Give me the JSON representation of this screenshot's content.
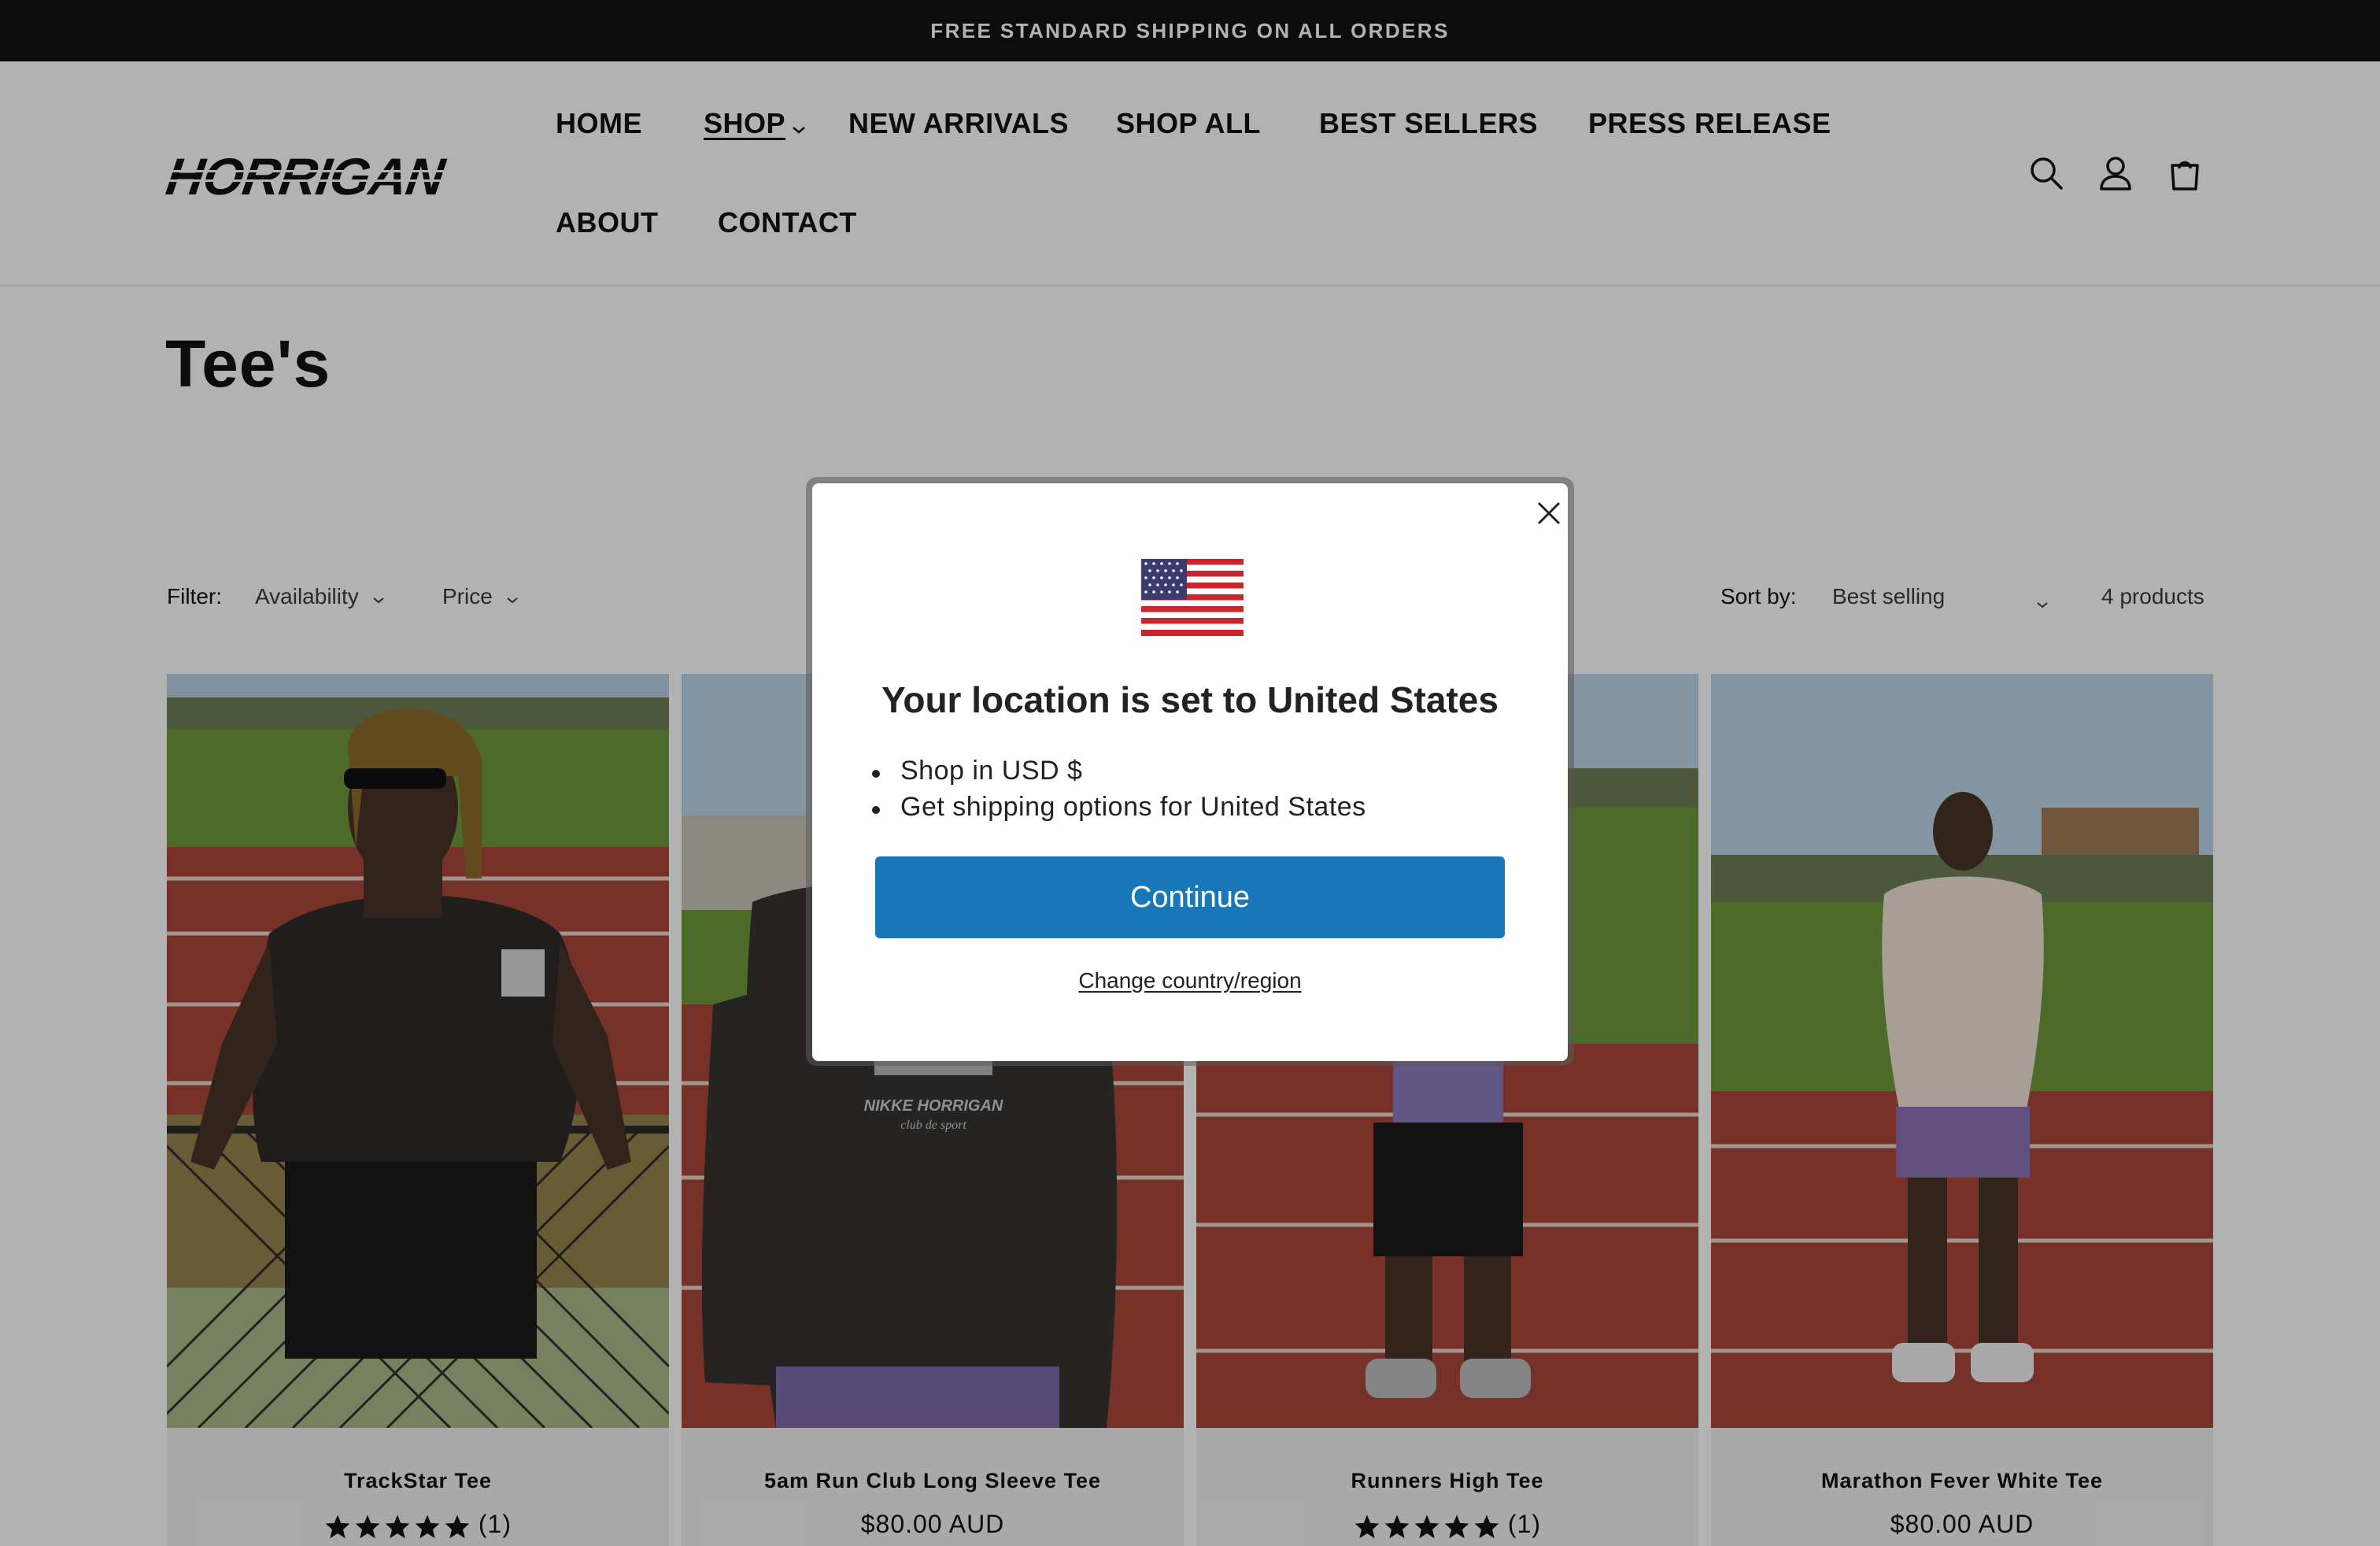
{
  "announcement": "FREE STANDARD SHIPPING ON ALL ORDERS",
  "brand": "HORRIGAN",
  "nav": {
    "home": "HOME",
    "shop": "SHOP",
    "new_arrivals": "NEW ARRIVALS",
    "shop_all": "SHOP ALL",
    "best_sellers": "BEST SELLERS",
    "press_release": "PRESS RELEASE",
    "about": "ABOUT",
    "contact": "CONTACT"
  },
  "header_icons": [
    "search-icon",
    "account-icon",
    "cart-icon"
  ],
  "page_title": "Tee's",
  "filters": {
    "label": "Filter:",
    "availability": "Availability",
    "price": "Price",
    "sort_label": "Sort by:",
    "sort_value": "Best selling",
    "count": "4 products"
  },
  "products": [
    {
      "title": "TrackStar Tee",
      "rating_count": "(1)",
      "stars": 5
    },
    {
      "title": "5am Run Club Long Sleeve Tee",
      "price": "$80.00 AUD"
    },
    {
      "title": "Runners High Tee",
      "rating_count": "(1)",
      "stars": 5
    },
    {
      "title": "Marathon Fever White Tee",
      "price": "$80.00 AUD"
    }
  ],
  "print_text": "NIKKE HORRIGAN",
  "print_sub": "club de sport",
  "modal": {
    "title": "Your location is set to United States",
    "bullets": [
      "Shop in USD $",
      "Get shipping options for United States"
    ],
    "continue": "Continue",
    "change": "Change country/region"
  },
  "colors": {
    "announcement_bg": "#121212",
    "button_blue": "#1878b9",
    "track": "#a9473b",
    "grass": "#6e9a3c"
  }
}
